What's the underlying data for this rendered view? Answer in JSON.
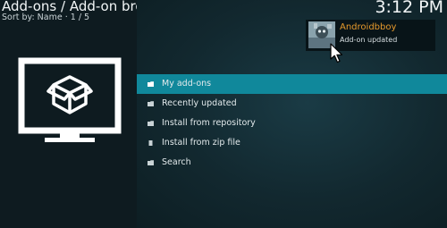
{
  "header": {
    "title": "Add-ons / Add-on browser",
    "subtitle": "Sort by: Name  ·  1 / 5",
    "clock": "3:12 PM"
  },
  "colors": {
    "focus": "#10889b",
    "notification_title": "#e79a2c"
  },
  "left_panel": {
    "icon": "monitor-package-icon"
  },
  "menu": {
    "items": [
      {
        "label": "My add-ons",
        "icon": "folder-icon",
        "focused": true
      },
      {
        "label": "Recently updated",
        "icon": "folder-icon",
        "focused": false
      },
      {
        "label": "Install from repository",
        "icon": "folder-icon",
        "focused": false
      },
      {
        "label": "Install from zip file",
        "icon": "zip-icon",
        "focused": false
      },
      {
        "label": "Search",
        "icon": "folder-icon",
        "focused": false
      }
    ]
  },
  "notification": {
    "title": "Androidbboy",
    "message": "Add-on updated",
    "icon": "addon-thumbnail"
  }
}
